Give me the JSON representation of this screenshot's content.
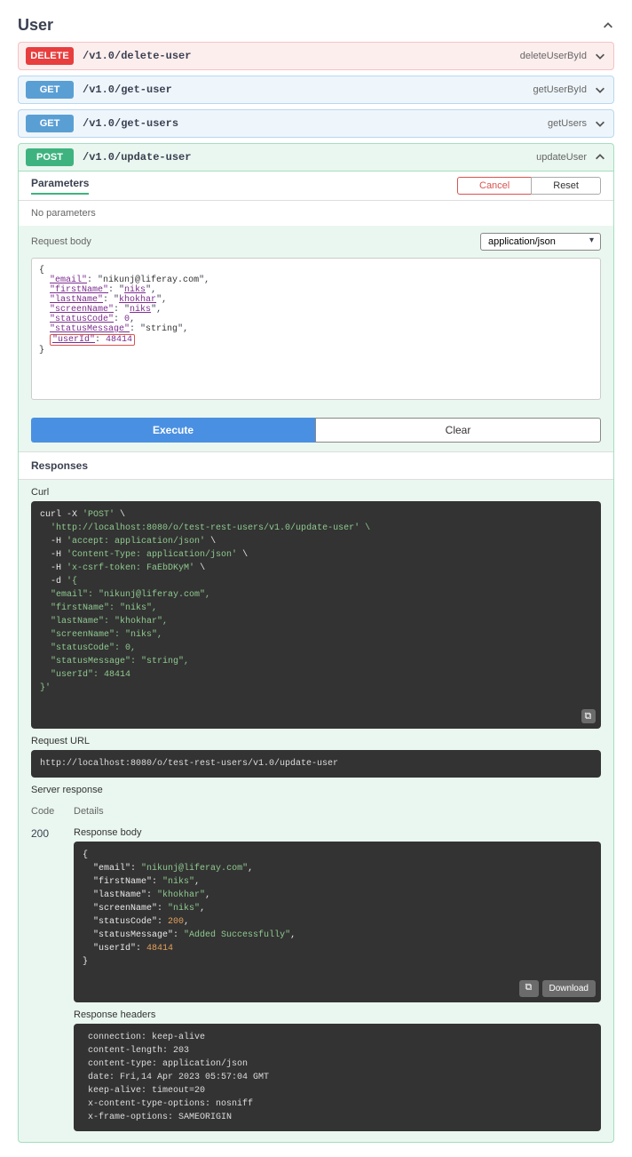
{
  "section": {
    "title": "User"
  },
  "endpoints": {
    "delete": {
      "method": "DELETE",
      "path": "/v1.0/delete-user",
      "opId": "deleteUserById"
    },
    "getUser": {
      "method": "GET",
      "path": "/v1.0/get-user",
      "opId": "getUserById"
    },
    "getUsers": {
      "method": "GET",
      "path": "/v1.0/get-users",
      "opId": "getUsers"
    },
    "post": {
      "method": "POST",
      "path": "/v1.0/update-user",
      "opId": "updateUser"
    }
  },
  "labels": {
    "parameters": "Parameters",
    "cancel": "Cancel",
    "reset": "Reset",
    "noParams": "No parameters",
    "requestBody": "Request body",
    "contentType": "application/json",
    "execute": "Execute",
    "clear": "Clear",
    "responses": "Responses",
    "curl": "Curl",
    "requestUrl": "Request URL",
    "serverResponse": "Server response",
    "code": "Code",
    "details": "Details",
    "responseBody": "Response body",
    "responseHeaders": "Response headers",
    "download": "Download"
  },
  "requestBodyJson": {
    "email": "nikunj@liferay.com",
    "firstName": "niks",
    "lastName": "khokhar",
    "screenName": "niks",
    "statusCode": 0,
    "statusMessage": "string",
    "userId": 48414
  },
  "curl": {
    "line1a": "curl -X ",
    "line1b": "'POST'",
    "line1c": " \\",
    "line2": "  'http://localhost:8080/o/test-rest-users/v1.0/update-user' \\",
    "line3a": "  -H ",
    "line3b": "'accept: application/json'",
    "line3c": " \\",
    "line4a": "  -H ",
    "line4b": "'Content-Type: application/json'",
    "line4c": " \\",
    "line5a": "  -H ",
    "line5b": "'x-csrf-token: FaEbDKyM'",
    "line5c": " \\",
    "line6a": "  -d ",
    "line6b": "'{",
    "line7": "  \"email\": \"nikunj@liferay.com\",",
    "line8": "  \"firstName\": \"niks\",",
    "line9": "  \"lastName\": \"khokhar\",",
    "line10": "  \"screenName\": \"niks\",",
    "line11": "  \"statusCode\": 0,",
    "line12": "  \"statusMessage\": \"string\",",
    "line13": "  \"userId\": 48414",
    "line14": "}'"
  },
  "requestUrl": "http://localhost:8080/o/test-rest-users/v1.0/update-user",
  "response": {
    "code": "200",
    "body": {
      "email": "nikunj@liferay.com",
      "firstName": "niks",
      "lastName": "khokhar",
      "screenName": "niks",
      "statusCode": 200,
      "statusMessage": "Added Successfully",
      "userId": 48414
    },
    "headers": " connection: keep-alive \n content-length: 203 \n content-type: application/json \n date: Fri,14 Apr 2023 05:57:04 GMT \n keep-alive: timeout=20 \n x-content-type-options: nosniff \n x-frame-options: SAMEORIGIN "
  }
}
